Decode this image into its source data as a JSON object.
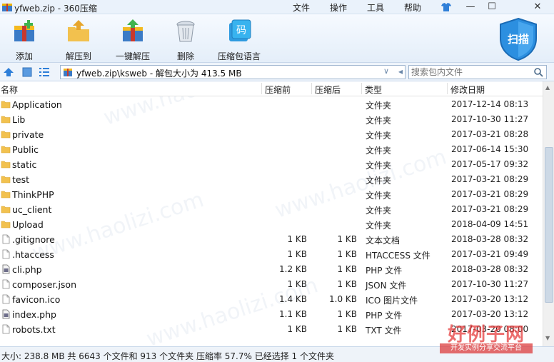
{
  "window": {
    "title": "yfweb.zip - 360压缩",
    "menu": [
      "文件",
      "操作",
      "工具",
      "帮助"
    ],
    "controls": {
      "minimize": "—",
      "maximize": "☐",
      "close": "✕"
    }
  },
  "toolbar": {
    "items": [
      {
        "label": "添加",
        "icon": "add-archive-icon"
      },
      {
        "label": "解压到",
        "icon": "extract-to-folder-icon"
      },
      {
        "label": "一键解压",
        "icon": "one-click-extract-icon"
      },
      {
        "label": "删除",
        "icon": "trash-can-icon"
      },
      {
        "label": "压缩包语言",
        "icon": "archive-language-icon"
      }
    ],
    "scan_label": "扫描"
  },
  "address": {
    "path": "yfweb.zip\\ksweb - 解包大小为 413.5 MB",
    "search_placeholder": "搜索包内文件"
  },
  "columns": {
    "name": "名称",
    "compressed": "压缩前",
    "size": "压缩后",
    "type": "类型",
    "modified": "修改日期"
  },
  "files": [
    {
      "name": "Application",
      "compressed": "",
      "size": "",
      "type": "文件夹",
      "modified": "2017-12-14 08:13",
      "icon": "folder"
    },
    {
      "name": "Lib",
      "compressed": "",
      "size": "",
      "type": "文件夹",
      "modified": "2017-10-30 11:27",
      "icon": "folder"
    },
    {
      "name": "private",
      "compressed": "",
      "size": "",
      "type": "文件夹",
      "modified": "2017-03-21 08:28",
      "icon": "folder"
    },
    {
      "name": "Public",
      "compressed": "",
      "size": "",
      "type": "文件夹",
      "modified": "2017-06-14 15:30",
      "icon": "folder"
    },
    {
      "name": "static",
      "compressed": "",
      "size": "",
      "type": "文件夹",
      "modified": "2017-05-17 09:32",
      "icon": "folder"
    },
    {
      "name": "test",
      "compressed": "",
      "size": "",
      "type": "文件夹",
      "modified": "2017-03-21 08:29",
      "icon": "folder"
    },
    {
      "name": "ThinkPHP",
      "compressed": "",
      "size": "",
      "type": "文件夹",
      "modified": "2017-03-21 08:29",
      "icon": "folder"
    },
    {
      "name": "uc_client",
      "compressed": "",
      "size": "",
      "type": "文件夹",
      "modified": "2017-03-21 08:29",
      "icon": "folder"
    },
    {
      "name": "Upload",
      "compressed": "",
      "size": "",
      "type": "文件夹",
      "modified": "2018-04-09 14:51",
      "icon": "folder"
    },
    {
      "name": ".gitignore",
      "compressed": "1 KB",
      "size": "1 KB",
      "type": "文本文档",
      "modified": "2018-03-28 08:32",
      "icon": "file"
    },
    {
      "name": ".htaccess",
      "compressed": "1 KB",
      "size": "1 KB",
      "type": "HTACCESS 文件",
      "modified": "2017-03-21 09:49",
      "icon": "file"
    },
    {
      "name": "cli.php",
      "compressed": "1.2 KB",
      "size": "1 KB",
      "type": "PHP 文件",
      "modified": "2018-03-28 08:32",
      "icon": "php"
    },
    {
      "name": "composer.json",
      "compressed": "1 KB",
      "size": "1 KB",
      "type": "JSON 文件",
      "modified": "2017-10-30 11:27",
      "icon": "file"
    },
    {
      "name": "favicon.ico",
      "compressed": "1.4 KB",
      "size": "1.0 KB",
      "type": "ICO 图片文件",
      "modified": "2017-03-20 13:12",
      "icon": "file"
    },
    {
      "name": "index.php",
      "compressed": "1.1 KB",
      "size": "1 KB",
      "type": "PHP 文件",
      "modified": "2017-03-20 13:12",
      "icon": "php"
    },
    {
      "name": "robots.txt",
      "compressed": "1 KB",
      "size": "1 KB",
      "type": "TXT 文件",
      "modified": "2017-03-20 08:00",
      "icon": "file"
    }
  ],
  "status": "大小: 238.8 MB 共 6643 个文件和 913 个文件夹 压缩率 57.7% 已经选择 1 个文件夹",
  "watermark": {
    "text": "www.haolizi.com",
    "logo_title": "好例子网",
    "logo_subtitle": "开发实例分享交流平台"
  },
  "colors": {
    "accent": "#2f7fd8",
    "folder": "#f2c14e"
  }
}
